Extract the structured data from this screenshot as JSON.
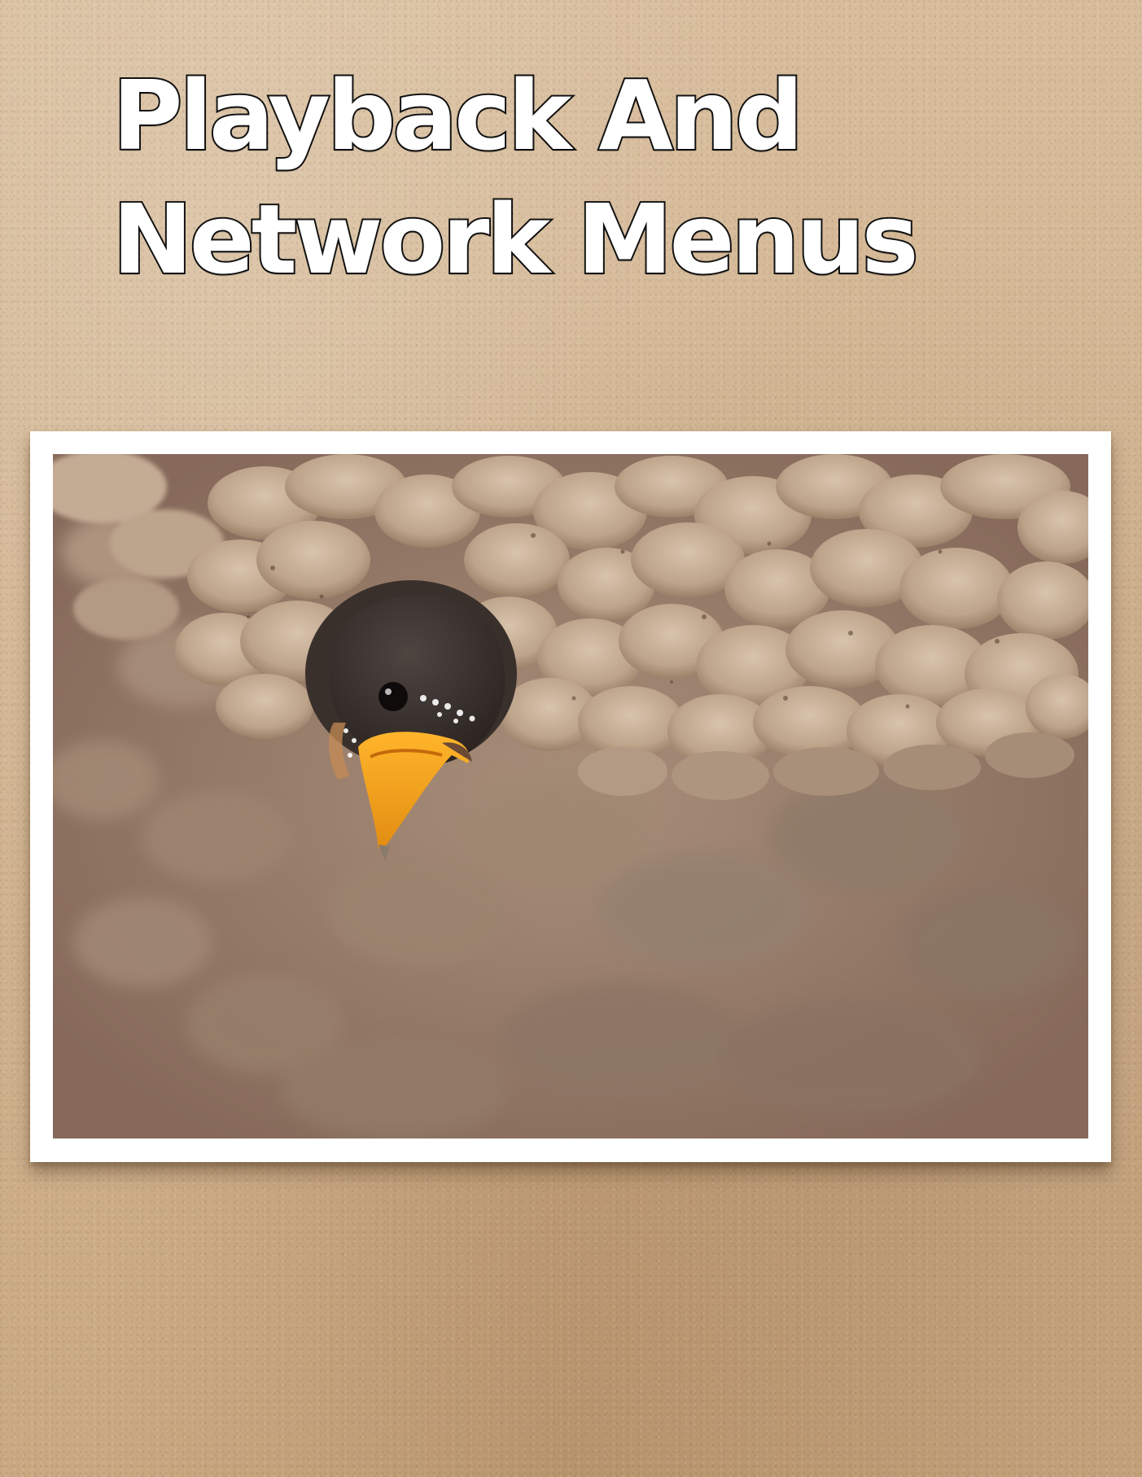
{
  "title": {
    "line1": "Playback And",
    "line2": "Network Menus"
  },
  "colors": {
    "paper": "#d2b592",
    "title_fill": "#ffffff",
    "title_outline": "#111111",
    "frame": "#ffffff",
    "beak": "#f3a51c"
  }
}
